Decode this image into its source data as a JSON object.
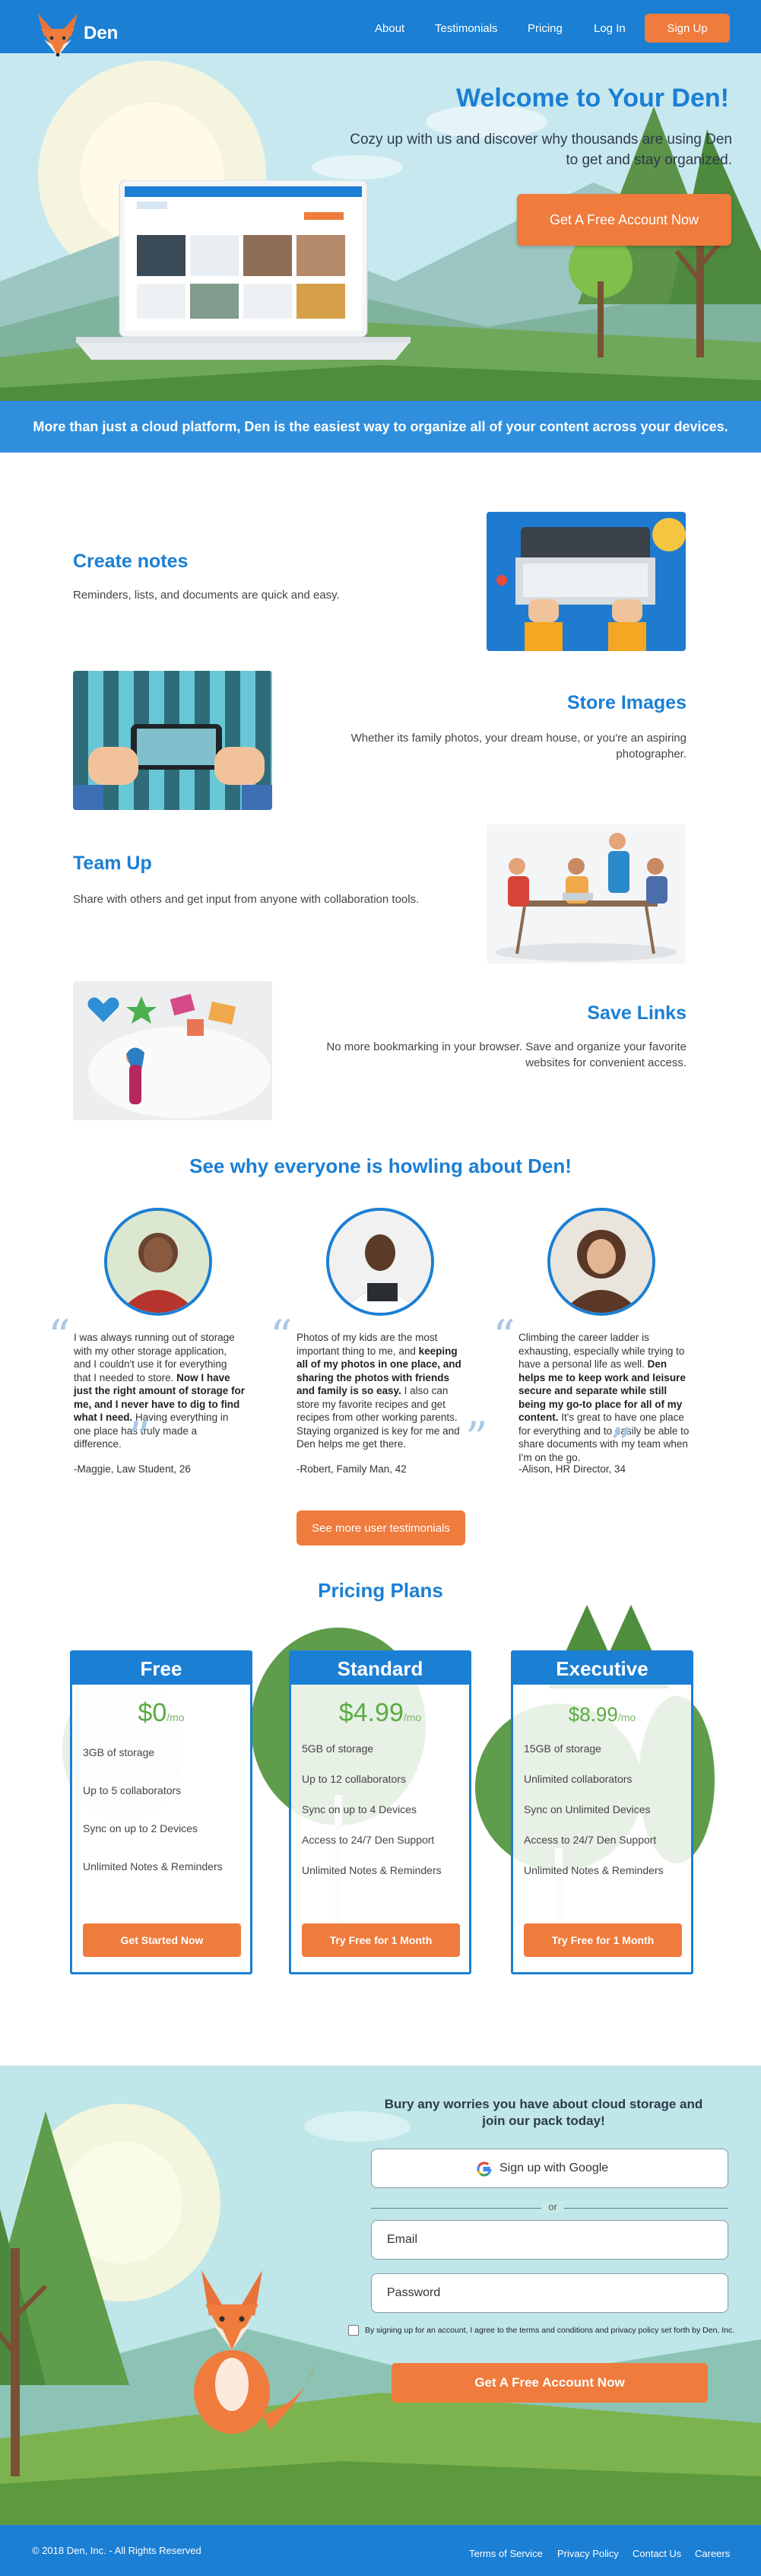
{
  "nav": {
    "brand": "Den",
    "links": [
      "About",
      "Testimonials",
      "Pricing",
      "Log In"
    ],
    "signup": "Sign Up"
  },
  "hero": {
    "title": "Welcome to Your Den!",
    "subtitle": "Cozy up with us and discover why thousands are using Den to get and stay organized.",
    "cta": "Get A Free Account Now"
  },
  "banner": "More than just a cloud platform, Den is the easiest way to organize all of your content across your devices.",
  "features": [
    {
      "title": "Create notes",
      "text": "Reminders, lists, and documents are quick and easy."
    },
    {
      "title": "Store Images",
      "text": "Whether its family photos, your dream house, or you're an aspiring photographer."
    },
    {
      "title": "Team Up",
      "text": "Share with others and get input from anyone with collaboration tools."
    },
    {
      "title": "Save Links",
      "text": "No more bookmarking in your browser. Save and organize your favorite websites for convenient access."
    }
  ],
  "testimonials": {
    "title": "See why everyone is howling about Den!",
    "items": [
      {
        "parts": [
          {
            "t": "I was always running out of storage with my other storage application, and I couldn't use it for everything that I needed to store. ",
            "b": false
          },
          {
            "t": "Now I have just the right amount of storage for me, and I never have to dig to find what I need.",
            "b": true
          },
          {
            "t": " Having everything in one place has truly made a difference.",
            "b": false
          }
        ],
        "author": "-Maggie, Law Student, 26"
      },
      {
        "parts": [
          {
            "t": "Photos of my kids are the most important thing to me, and ",
            "b": false
          },
          {
            "t": "keeping all of my photos in one place, and sharing the photos with friends and family is so easy.",
            "b": true
          },
          {
            "t": " I also can store my favorite recipes and get recipes from other working parents. Staying organized is key for me and Den helps me get there.",
            "b": false
          }
        ],
        "author": "-Robert, Family Man, 42"
      },
      {
        "parts": [
          {
            "t": "Climbing the career ladder is exhausting, especially while trying to have a personal life as well. ",
            "b": false
          },
          {
            "t": "Den helps me to keep work and leisure secure and separate while still being my go-to place for all of my content.",
            "b": true
          },
          {
            "t": " It's great to have one place for everything and to easily be able to share documents with my team when I'm on the go.",
            "b": false
          }
        ],
        "author": "-Alison, HR Director, 34"
      }
    ],
    "more": "See more user testimonials"
  },
  "pricing": {
    "title": "Pricing Plans",
    "plans": [
      {
        "name": "Free",
        "price": "$0",
        "unit": "/mo",
        "features": [
          "3GB of storage",
          "Up to 5 collaborators",
          "Sync on up to 2 Devices",
          "Unlimited Notes & Reminders"
        ],
        "button": "Get Started Now"
      },
      {
        "name": "Standard",
        "price": "$4.99",
        "unit": "/mo",
        "features": [
          "5GB of storage",
          "Up to 12 collaborators",
          "Sync on up to 4 Devices",
          "Access to 24/7 Den Support",
          "Unlimited Notes & Reminders"
        ],
        "button": "Try Free for 1 Month"
      },
      {
        "name": "Executive",
        "price": "$8.99",
        "unit": "/mo",
        "features": [
          "15GB of storage",
          "Unlimited collaborators",
          "Sync on Unlimited Devices",
          "Access to 24/7 Den Support",
          "Unlimited Notes & Reminders"
        ],
        "button": "Try Free for 1 Month"
      }
    ]
  },
  "signup": {
    "title": "Bury any worries you have about cloud storage and join our pack today!",
    "google": "Sign up with Google",
    "or": "or",
    "email_placeholder": "Email",
    "password_placeholder": "Password",
    "terms": "By signing up for an account, I agree to the terms and conditions and privacy policy set forth by Den, Inc.",
    "cta": "Get A Free Account Now"
  },
  "footer": {
    "copyright": "© 2018 Den, Inc. - All Rights Reserved",
    "links": [
      "Terms of Service",
      "Privacy Policy",
      "Contact Us",
      "Careers"
    ]
  },
  "colors": {
    "primary": "#1b7fd4",
    "accent": "#ef7b3c",
    "price_green": "#5aac44"
  }
}
